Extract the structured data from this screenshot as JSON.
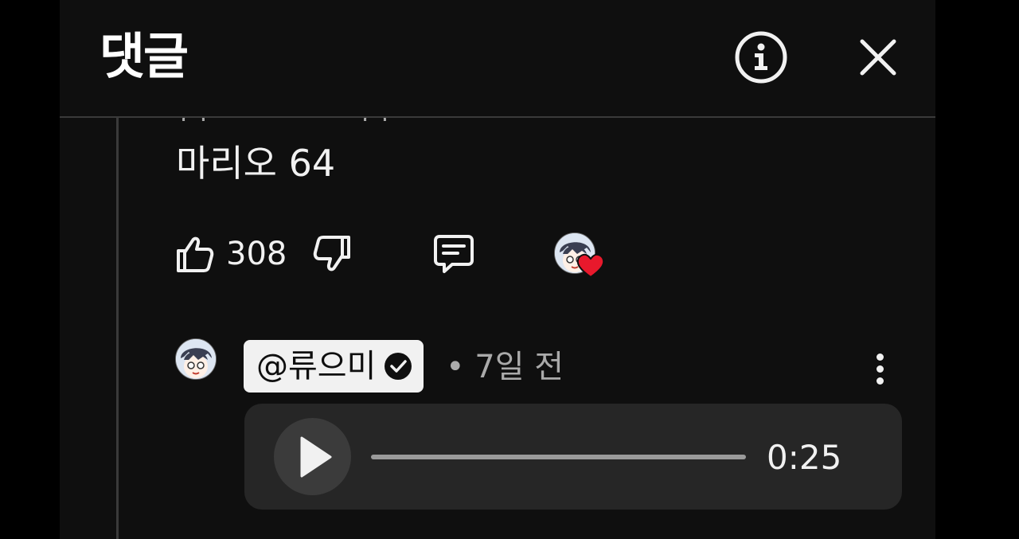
{
  "header": {
    "title": "댓글",
    "info_icon": "info-circle-icon",
    "close_icon": "close-x-icon"
  },
  "comment": {
    "text": "마리오 64",
    "like_count": "308",
    "icons": {
      "like": "thumb-up-icon",
      "dislike": "thumb-down-icon",
      "reply": "comment-icon",
      "creator_heart": "heart-icon"
    }
  },
  "reply": {
    "author": "@류으미",
    "verified_icon": "verified-check-icon",
    "meta": "• 7일 전",
    "menu_icon": "more-vertical-icon",
    "audio": {
      "duration": "0:25",
      "progress": 0,
      "play_icon": "play-icon"
    }
  },
  "colors": {
    "panel_bg": "#0f0f0f",
    "heart": "#e8192c",
    "chip_bg": "#f1f1f1",
    "audio_bg": "#262626"
  }
}
